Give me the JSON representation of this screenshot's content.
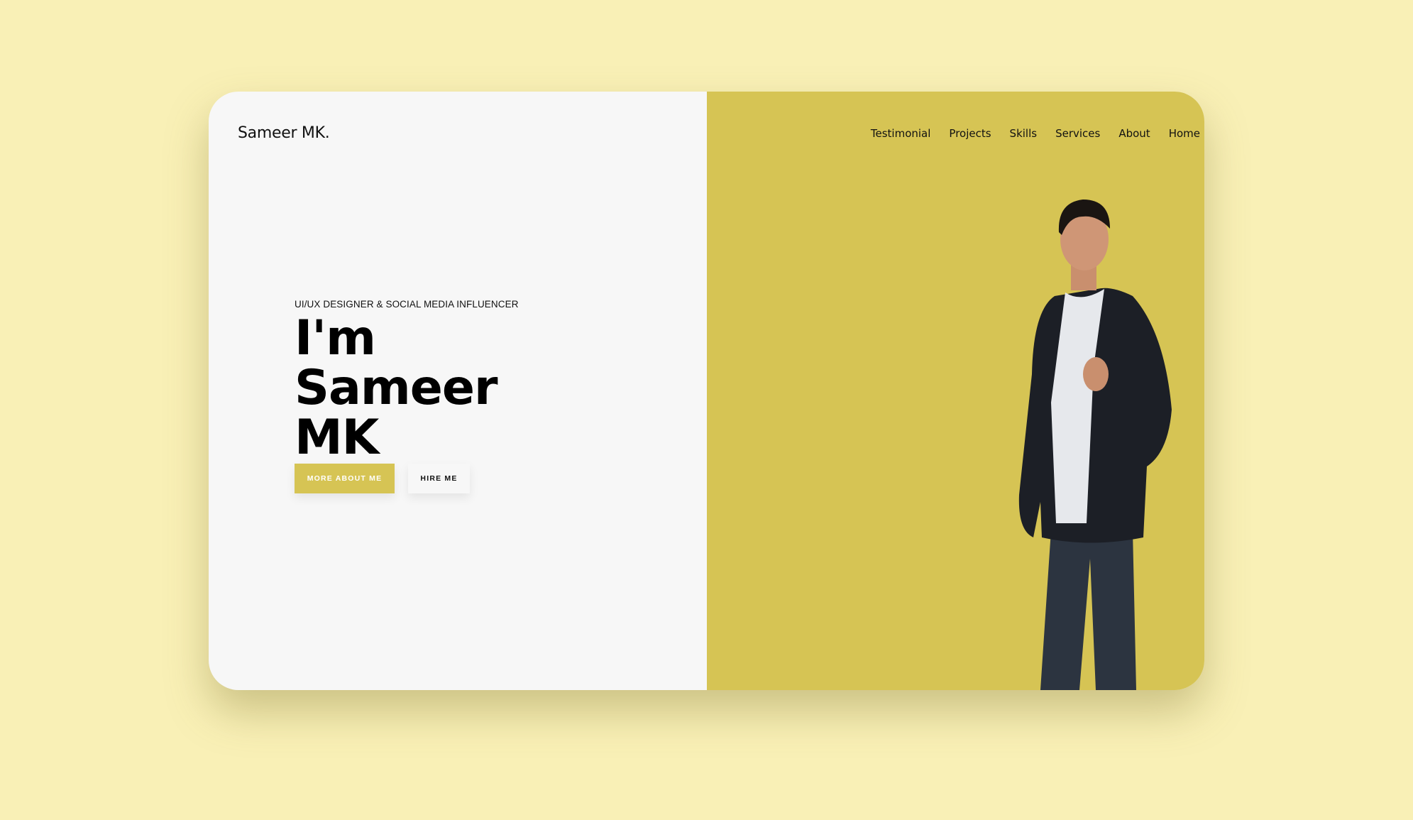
{
  "brand": {
    "logo": "Sameer MK."
  },
  "nav": {
    "items": [
      "Testimonial",
      "Projects",
      "Skills",
      "Services",
      "About",
      "Home"
    ]
  },
  "hero": {
    "subtitle": "UI/UX DESIGNER & SOCIAL MEDIA INFLUENCER",
    "title_lines": [
      "I'm",
      "Sameer",
      "MK"
    ],
    "primary_button": "MORE ABOUT ME",
    "secondary_button": "HIRE ME"
  },
  "colors": {
    "page_bg": "#f9f0b6",
    "panel_left": "#f7f7f7",
    "accent": "#d6c454"
  }
}
